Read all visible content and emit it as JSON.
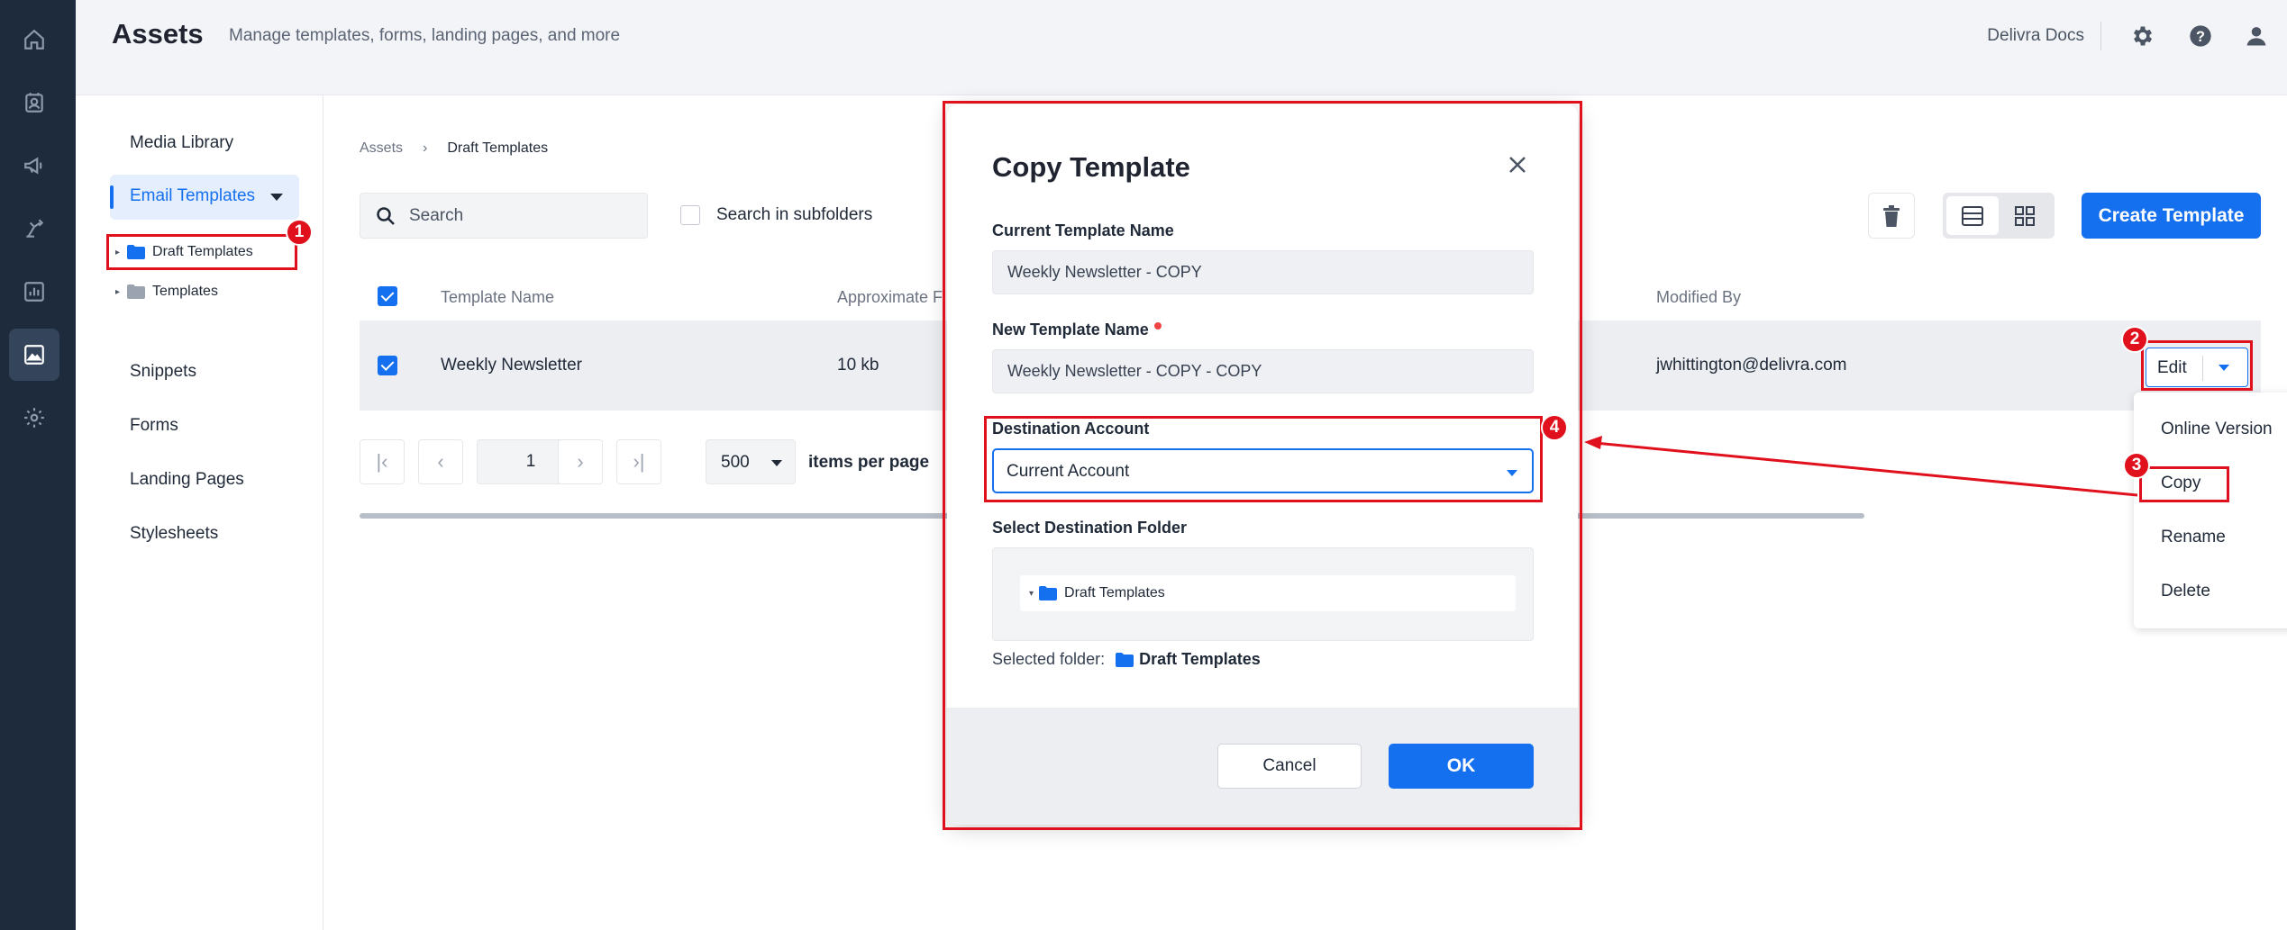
{
  "header": {
    "title": "Assets",
    "subtitle": "Manage templates, forms, landing pages, and more",
    "docs_link": "Delivra Docs"
  },
  "sidebar": {
    "media_library": "Media Library",
    "email_templates": "Email Templates",
    "folders": [
      "Draft Templates",
      "Templates"
    ],
    "snippets": "Snippets",
    "forms": "Forms",
    "landing_pages": "Landing Pages",
    "stylesheets": "Stylesheets"
  },
  "breadcrumb": {
    "root": "Assets",
    "current": "Draft Templates"
  },
  "toolbar": {
    "search_placeholder": "Search",
    "search_subfolders": "Search in subfolders",
    "create_button": "Create Template"
  },
  "table": {
    "headers": [
      "Template Name",
      "Approximate F",
      "Modified By"
    ],
    "rows": [
      {
        "name": "Weekly Newsletter",
        "size": "10 kb",
        "modified_by": "jwhittington@delivra.com",
        "action": "Edit"
      }
    ]
  },
  "pagination": {
    "page": "1",
    "per_page": "500",
    "per_page_label": "items per page"
  },
  "context_menu": {
    "items": [
      "Online Version",
      "Copy",
      "Rename",
      "Delete"
    ]
  },
  "modal": {
    "title": "Copy Template",
    "current_name_label": "Current Template Name",
    "current_name_value": "Weekly Newsletter - COPY",
    "new_name_label": "New Template Name",
    "new_name_value": "Weekly Newsletter - COPY - COPY",
    "dest_account_label": "Destination Account",
    "dest_account_value": "Current Account",
    "dest_folder_label": "Select Destination Folder",
    "folder_tree_item": "Draft Templates",
    "selected_folder_label": "Selected folder:",
    "selected_folder_value": "Draft Templates",
    "cancel": "Cancel",
    "ok": "OK"
  },
  "annotations": {
    "badges": [
      "1",
      "2",
      "3",
      "4"
    ]
  },
  "colors": {
    "accent": "#1570ef",
    "rail": "#1e2b3d",
    "annotation": "#e0101d"
  }
}
